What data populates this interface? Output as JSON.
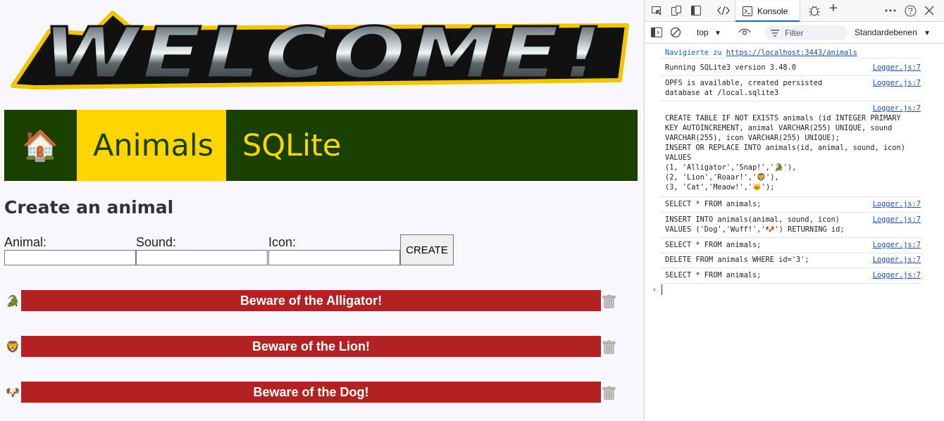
{
  "page": {
    "banner": "WELCOME!",
    "nav": {
      "home_icon": "🏠",
      "animals": "Animals",
      "sqlite": "SQLite"
    },
    "form": {
      "title": "Create an animal",
      "animal_label": "Animal:",
      "sound_label": "Sound:",
      "icon_label": "Icon:",
      "animal_value": "",
      "sound_value": "",
      "icon_value": "",
      "create_label": "CREATE"
    },
    "animals": [
      {
        "icon": "🐊",
        "text": "Beware of the Alligator!"
      },
      {
        "icon": "🦁",
        "text": "Beware of the Lion!"
      },
      {
        "icon": "🐶",
        "text": "Beware of the Dog!"
      }
    ],
    "colors": {
      "nav_bg": "#1a4000",
      "nav_accent": "#ffd500",
      "bar_red": "#b22222"
    },
    "icons": {
      "delete": "trash-icon"
    }
  },
  "devtools": {
    "tabs": {
      "console": "Konsole"
    },
    "toolbar": {
      "context": "top",
      "filter_placeholder": "Filter",
      "levels": "Standardebenen"
    },
    "nav_message": {
      "prefix": "Navigierte zu ",
      "url": "https://localhost:3443/animals"
    },
    "logs": [
      {
        "text": "Running SQLite3 version 3.48.0",
        "source": "Logger.js:7"
      },
      {
        "text": "OPFS is available, created persisted\ndatabase at /local.sqlite3",
        "source": "Logger.js:7"
      },
      {
        "text": "\nCREATE TABLE IF NOT EXISTS animals (id INTEGER PRIMARY\nKEY AUTOINCREMENT, animal VARCHAR(255) UNIQUE, sound\nVARCHAR(255), icon VARCHAR(255) UNIQUE);\nINSERT OR REPLACE INTO animals(id, animal, sound, icon)\nVALUES\n(1, 'Alligator','Snap!','🐊'),\n(2, 'Lion','Roaar!','🦁'),\n(3, 'Cat','Meaow!','🐱');",
        "source": "Logger.js:7"
      },
      {
        "text": "SELECT * FROM animals;",
        "source": "Logger.js:7"
      },
      {
        "text": "INSERT INTO animals(animal, sound, icon)\nVALUES ('Dog','Wuff!','🐶') RETURNING id;",
        "source": "Logger.js:7"
      },
      {
        "text": "SELECT * FROM animals;",
        "source": "Logger.js:7"
      },
      {
        "text": "DELETE FROM animals WHERE id='3';",
        "source": "Logger.js:7"
      },
      {
        "text": "SELECT * FROM animals;",
        "source": "Logger.js:7"
      }
    ],
    "prompt": "›"
  }
}
